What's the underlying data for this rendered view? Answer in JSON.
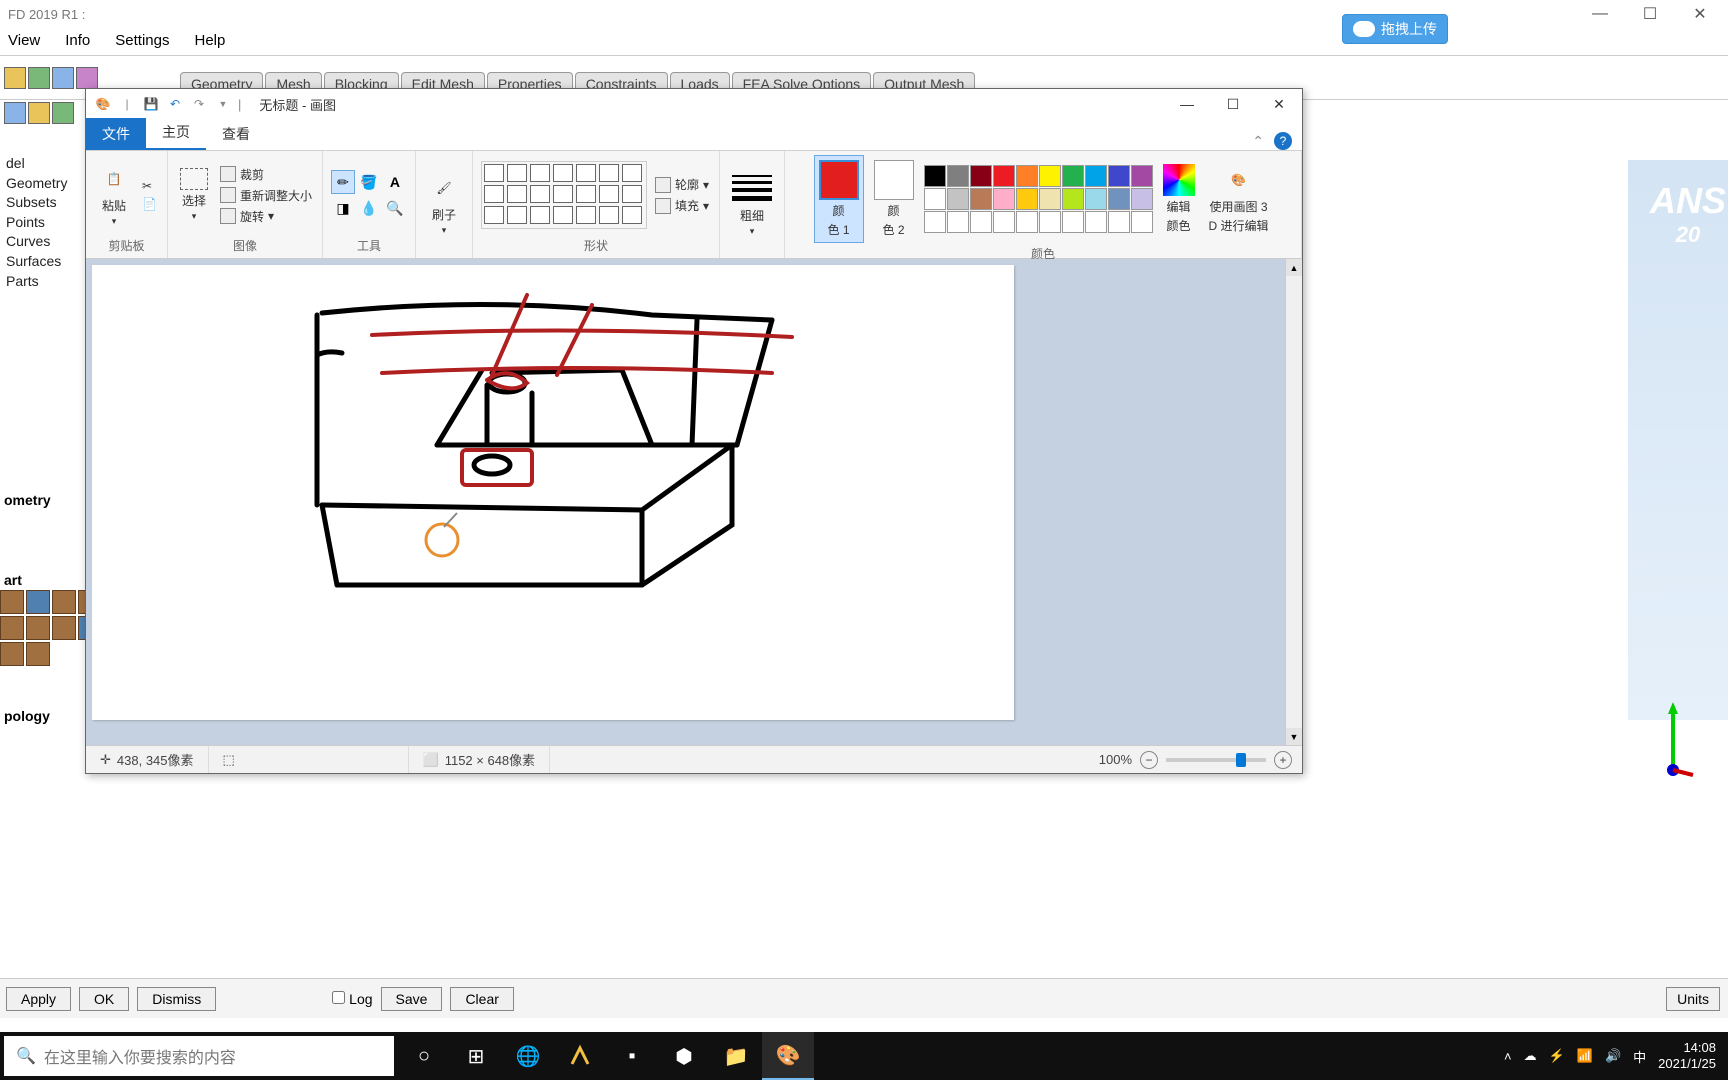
{
  "ansys": {
    "title": "FD 2019 R1 :",
    "cloud_upload": "拖拽上传",
    "menu": [
      "View",
      "Info",
      "Settings",
      "Help"
    ],
    "tabs": [
      "Geometry",
      "Mesh",
      "Blocking",
      "Edit Mesh",
      "Properties",
      "Constraints",
      "Loads",
      "FEA Solve Options",
      "Output Mesh"
    ],
    "tree": [
      "del",
      "Geometry",
      " Subsets",
      " Points",
      " Curves",
      " Surfaces",
      "Parts"
    ],
    "side_ometry": "ometry",
    "side_art": "art",
    "side_pology": "pology",
    "brand": "ANS",
    "brand_sub": "20",
    "axis_y": "Y",
    "bottom": {
      "apply": "Apply",
      "ok": "OK",
      "dismiss": "Dismiss",
      "log": "Log",
      "save": "Save",
      "clear": "Clear",
      "units": "Units"
    }
  },
  "paint": {
    "title": "无标题 - 画图",
    "tabs": {
      "file": "文件",
      "home": "主页",
      "view": "查看"
    },
    "clipboard": {
      "paste": "粘贴",
      "cut": "",
      "copy": "",
      "label": "剪贴板"
    },
    "image": {
      "select": "选择",
      "crop": "裁剪",
      "resize": "重新调整大小",
      "rotate": "旋转",
      "label": "图像"
    },
    "tools": {
      "label": "工具"
    },
    "brush": {
      "label": "刷子"
    },
    "shapes": {
      "outline": "轮廓",
      "fill": "填充",
      "label": "形状"
    },
    "thickness": {
      "label": "粗细"
    },
    "color1": {
      "label1": "颜",
      "label2": "色 1"
    },
    "color2": {
      "label1": "颜",
      "label2": "色 2"
    },
    "colors_label": "颜色",
    "edit_colors": {
      "l1": "编辑",
      "l2": "颜色"
    },
    "paint3d": {
      "l1": "使用画图 3",
      "l2": "D 进行编辑"
    },
    "palette_row1": [
      "#000000",
      "#7f7f7f",
      "#880015",
      "#ed1c24",
      "#ff7f27",
      "#fff200",
      "#22b14c",
      "#00a2e8",
      "#3f48cc",
      "#a349a4"
    ],
    "palette_row2": [
      "#ffffff",
      "#c3c3c3",
      "#b97a57",
      "#ffaec9",
      "#ffc90e",
      "#efe4b0",
      "#b5e61d",
      "#99d9ea",
      "#7092be",
      "#c8bfe7"
    ],
    "palette_row3": [
      "#ffffff",
      "#ffffff",
      "#ffffff",
      "#ffffff",
      "#ffffff",
      "#ffffff",
      "#ffffff",
      "#ffffff",
      "#ffffff",
      "#ffffff"
    ],
    "status": {
      "pos": "438, 345像素",
      "sel": "",
      "size": "1152 × 648像素",
      "zoom": "100%"
    }
  },
  "taskbar": {
    "search_placeholder": "在这里输入你要搜索的内容",
    "ime": "中",
    "time": "14:08",
    "date": "2021/1/25"
  }
}
